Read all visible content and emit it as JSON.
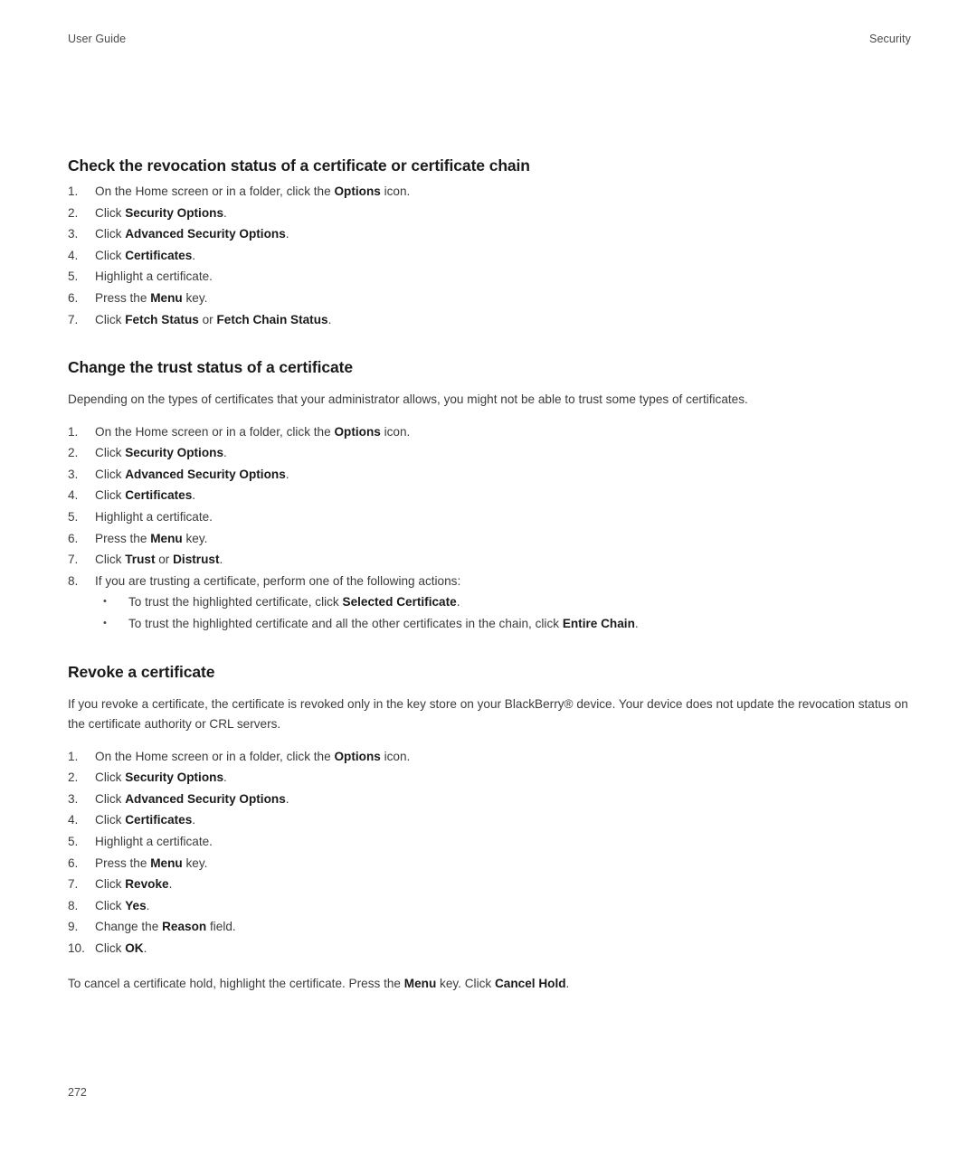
{
  "header": {
    "left": "User Guide",
    "right": "Security"
  },
  "footer": {
    "page_number": "272"
  },
  "sections": [
    {
      "title": "Check the revocation status of a certificate or certificate chain",
      "steps": [
        {
          "num": "1.",
          "parts": [
            {
              "t": "On the Home screen or in a folder, click the ",
              "b": false
            },
            {
              "t": "Options",
              "b": true
            },
            {
              "t": " icon.",
              "b": false
            }
          ]
        },
        {
          "num": "2.",
          "parts": [
            {
              "t": "Click ",
              "b": false
            },
            {
              "t": "Security Options",
              "b": true
            },
            {
              "t": ".",
              "b": false
            }
          ]
        },
        {
          "num": "3.",
          "parts": [
            {
              "t": "Click ",
              "b": false
            },
            {
              "t": "Advanced Security Options",
              "b": true
            },
            {
              "t": ".",
              "b": false
            }
          ]
        },
        {
          "num": "4.",
          "parts": [
            {
              "t": "Click ",
              "b": false
            },
            {
              "t": "Certificates",
              "b": true
            },
            {
              "t": ".",
              "b": false
            }
          ]
        },
        {
          "num": "5.",
          "parts": [
            {
              "t": "Highlight a certificate.",
              "b": false
            }
          ]
        },
        {
          "num": "6.",
          "parts": [
            {
              "t": "Press the ",
              "b": false
            },
            {
              "t": "Menu",
              "b": true
            },
            {
              "t": " key.",
              "b": false
            }
          ]
        },
        {
          "num": "7.",
          "parts": [
            {
              "t": "Click ",
              "b": false
            },
            {
              "t": "Fetch Status",
              "b": true
            },
            {
              "t": " or ",
              "b": false
            },
            {
              "t": "Fetch Chain Status",
              "b": true
            },
            {
              "t": ".",
              "b": false
            }
          ]
        }
      ]
    },
    {
      "title": "Change the trust status of a certificate",
      "intro": "Depending on the types of certificates that your administrator allows, you might not be able to trust some types of certificates.",
      "steps": [
        {
          "num": "1.",
          "parts": [
            {
              "t": "On the Home screen or in a folder, click the ",
              "b": false
            },
            {
              "t": "Options",
              "b": true
            },
            {
              "t": " icon.",
              "b": false
            }
          ]
        },
        {
          "num": "2.",
          "parts": [
            {
              "t": "Click ",
              "b": false
            },
            {
              "t": "Security Options",
              "b": true
            },
            {
              "t": ".",
              "b": false
            }
          ]
        },
        {
          "num": "3.",
          "parts": [
            {
              "t": "Click ",
              "b": false
            },
            {
              "t": "Advanced Security Options",
              "b": true
            },
            {
              "t": ".",
              "b": false
            }
          ]
        },
        {
          "num": "4.",
          "parts": [
            {
              "t": "Click ",
              "b": false
            },
            {
              "t": "Certificates",
              "b": true
            },
            {
              "t": ".",
              "b": false
            }
          ]
        },
        {
          "num": "5.",
          "parts": [
            {
              "t": "Highlight a certificate.",
              "b": false
            }
          ]
        },
        {
          "num": "6.",
          "parts": [
            {
              "t": "Press the ",
              "b": false
            },
            {
              "t": "Menu",
              "b": true
            },
            {
              "t": " key.",
              "b": false
            }
          ]
        },
        {
          "num": "7.",
          "parts": [
            {
              "t": "Click ",
              "b": false
            },
            {
              "t": "Trust",
              "b": true
            },
            {
              "t": " or ",
              "b": false
            },
            {
              "t": "Distrust",
              "b": true
            },
            {
              "t": ".",
              "b": false
            }
          ]
        },
        {
          "num": "8.",
          "parts": [
            {
              "t": "If you are trusting a certificate, perform one of the following actions:",
              "b": false
            }
          ],
          "bullets": [
            {
              "parts": [
                {
                  "t": "To trust the highlighted certificate, click ",
                  "b": false
                },
                {
                  "t": "Selected Certificate",
                  "b": true
                },
                {
                  "t": ".",
                  "b": false
                }
              ]
            },
            {
              "parts": [
                {
                  "t": "To trust the highlighted certificate and all the other certificates in the chain, click ",
                  "b": false
                },
                {
                  "t": "Entire Chain",
                  "b": true
                },
                {
                  "t": ".",
                  "b": false
                }
              ]
            }
          ]
        }
      ]
    },
    {
      "title": "Revoke a certificate",
      "intro": "If you revoke a certificate, the certificate is revoked only in the key store on your BlackBerry® device. Your device does not update the revocation status on the certificate authority or CRL servers.",
      "steps": [
        {
          "num": "1.",
          "parts": [
            {
              "t": "On the Home screen or in a folder, click the ",
              "b": false
            },
            {
              "t": "Options",
              "b": true
            },
            {
              "t": " icon.",
              "b": false
            }
          ]
        },
        {
          "num": "2.",
          "parts": [
            {
              "t": "Click ",
              "b": false
            },
            {
              "t": "Security Options",
              "b": true
            },
            {
              "t": ".",
              "b": false
            }
          ]
        },
        {
          "num": "3.",
          "parts": [
            {
              "t": "Click ",
              "b": false
            },
            {
              "t": "Advanced Security Options",
              "b": true
            },
            {
              "t": ".",
              "b": false
            }
          ]
        },
        {
          "num": "4.",
          "parts": [
            {
              "t": "Click ",
              "b": false
            },
            {
              "t": "Certificates",
              "b": true
            },
            {
              "t": ".",
              "b": false
            }
          ]
        },
        {
          "num": "5.",
          "parts": [
            {
              "t": "Highlight a certificate.",
              "b": false
            }
          ]
        },
        {
          "num": "6.",
          "parts": [
            {
              "t": "Press the ",
              "b": false
            },
            {
              "t": "Menu",
              "b": true
            },
            {
              "t": " key.",
              "b": false
            }
          ]
        },
        {
          "num": "7.",
          "parts": [
            {
              "t": "Click ",
              "b": false
            },
            {
              "t": "Revoke",
              "b": true
            },
            {
              "t": ".",
              "b": false
            }
          ]
        },
        {
          "num": "8.",
          "parts": [
            {
              "t": "Click ",
              "b": false
            },
            {
              "t": "Yes",
              "b": true
            },
            {
              "t": ".",
              "b": false
            }
          ]
        },
        {
          "num": "9.",
          "parts": [
            {
              "t": "Change the ",
              "b": false
            },
            {
              "t": "Reason",
              "b": true
            },
            {
              "t": " field.",
              "b": false
            }
          ]
        },
        {
          "num": "10.",
          "parts": [
            {
              "t": "Click ",
              "b": false
            },
            {
              "t": "OK",
              "b": true
            },
            {
              "t": ".",
              "b": false
            }
          ]
        }
      ],
      "outro_parts": [
        {
          "t": "To cancel a certificate hold, highlight the certificate. Press the ",
          "b": false
        },
        {
          "t": "Menu",
          "b": true
        },
        {
          "t": " key. Click ",
          "b": false
        },
        {
          "t": "Cancel Hold",
          "b": true
        },
        {
          "t": ".",
          "b": false
        }
      ]
    }
  ]
}
